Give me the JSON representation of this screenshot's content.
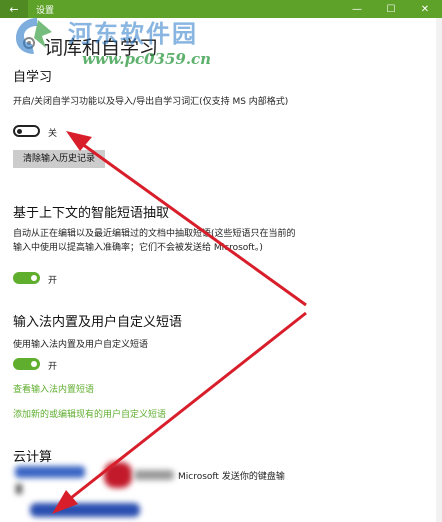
{
  "window": {
    "title": "设置",
    "back_glyph": "←",
    "minimize_glyph": "—",
    "maximize_glyph": "☐",
    "close_glyph": "✕"
  },
  "watermark": {
    "name": "河东软件园",
    "url": "www.pc0359.cn"
  },
  "page": {
    "title": "词库和自学习"
  },
  "self_learning": {
    "title": "自学习",
    "description": "开启/关闭自学习功能以及导入/导出自学习词汇(仅支持 MS 内部格式)",
    "toggle_state": "关",
    "clear_button": "清除输入历史记录"
  },
  "context_phrases": {
    "title": "基于上下文的智能短语抽取",
    "description": "自动从正在编辑以及最近编辑过的文档中抽取短语(这些短语只在当前的输入中使用以提高输入准确率；它们不会被发送给 Microsoft。)",
    "toggle_state": "开"
  },
  "builtin_phrases": {
    "title": "输入法内置及用户自定义短语",
    "description": "使用输入法内置及用户自定义短语",
    "toggle_state": "开",
    "link_view": "查看输入法内置短语",
    "link_edit": "添加新的或编辑现有的用户自定义短语"
  },
  "cloud": {
    "title": "云计算",
    "description_partial": "Microsoft 发送你的键盘输"
  },
  "colors": {
    "accent": "#5fae2e",
    "titlebar": "#5fa22a",
    "arrow": "#d81e2a"
  }
}
